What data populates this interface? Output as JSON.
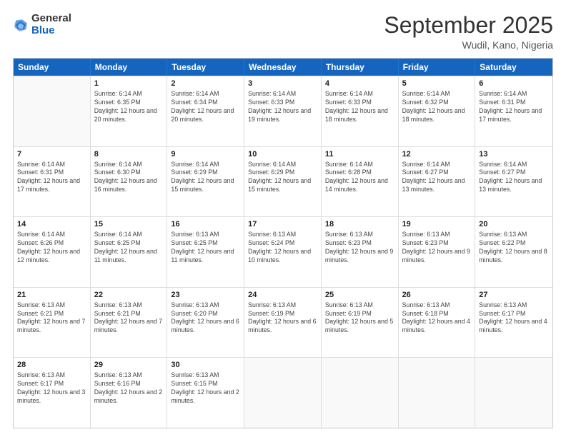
{
  "header": {
    "logo_general": "General",
    "logo_blue": "Blue",
    "month_year": "September 2025",
    "location": "Wudil, Kano, Nigeria"
  },
  "days_of_week": [
    "Sunday",
    "Monday",
    "Tuesday",
    "Wednesday",
    "Thursday",
    "Friday",
    "Saturday"
  ],
  "weeks": [
    [
      {
        "day": "",
        "empty": true
      },
      {
        "day": "1",
        "sunrise": "Sunrise: 6:14 AM",
        "sunset": "Sunset: 6:35 PM",
        "daylight": "Daylight: 12 hours and 20 minutes."
      },
      {
        "day": "2",
        "sunrise": "Sunrise: 6:14 AM",
        "sunset": "Sunset: 6:34 PM",
        "daylight": "Daylight: 12 hours and 20 minutes."
      },
      {
        "day": "3",
        "sunrise": "Sunrise: 6:14 AM",
        "sunset": "Sunset: 6:33 PM",
        "daylight": "Daylight: 12 hours and 19 minutes."
      },
      {
        "day": "4",
        "sunrise": "Sunrise: 6:14 AM",
        "sunset": "Sunset: 6:33 PM",
        "daylight": "Daylight: 12 hours and 18 minutes."
      },
      {
        "day": "5",
        "sunrise": "Sunrise: 6:14 AM",
        "sunset": "Sunset: 6:32 PM",
        "daylight": "Daylight: 12 hours and 18 minutes."
      },
      {
        "day": "6",
        "sunrise": "Sunrise: 6:14 AM",
        "sunset": "Sunset: 6:31 PM",
        "daylight": "Daylight: 12 hours and 17 minutes."
      }
    ],
    [
      {
        "day": "7",
        "sunrise": "Sunrise: 6:14 AM",
        "sunset": "Sunset: 6:31 PM",
        "daylight": "Daylight: 12 hours and 17 minutes."
      },
      {
        "day": "8",
        "sunrise": "Sunrise: 6:14 AM",
        "sunset": "Sunset: 6:30 PM",
        "daylight": "Daylight: 12 hours and 16 minutes."
      },
      {
        "day": "9",
        "sunrise": "Sunrise: 6:14 AM",
        "sunset": "Sunset: 6:29 PM",
        "daylight": "Daylight: 12 hours and 15 minutes."
      },
      {
        "day": "10",
        "sunrise": "Sunrise: 6:14 AM",
        "sunset": "Sunset: 6:29 PM",
        "daylight": "Daylight: 12 hours and 15 minutes."
      },
      {
        "day": "11",
        "sunrise": "Sunrise: 6:14 AM",
        "sunset": "Sunset: 6:28 PM",
        "daylight": "Daylight: 12 hours and 14 minutes."
      },
      {
        "day": "12",
        "sunrise": "Sunrise: 6:14 AM",
        "sunset": "Sunset: 6:27 PM",
        "daylight": "Daylight: 12 hours and 13 minutes."
      },
      {
        "day": "13",
        "sunrise": "Sunrise: 6:14 AM",
        "sunset": "Sunset: 6:27 PM",
        "daylight": "Daylight: 12 hours and 13 minutes."
      }
    ],
    [
      {
        "day": "14",
        "sunrise": "Sunrise: 6:14 AM",
        "sunset": "Sunset: 6:26 PM",
        "daylight": "Daylight: 12 hours and 12 minutes."
      },
      {
        "day": "15",
        "sunrise": "Sunrise: 6:14 AM",
        "sunset": "Sunset: 6:25 PM",
        "daylight": "Daylight: 12 hours and 11 minutes."
      },
      {
        "day": "16",
        "sunrise": "Sunrise: 6:13 AM",
        "sunset": "Sunset: 6:25 PM",
        "daylight": "Daylight: 12 hours and 11 minutes."
      },
      {
        "day": "17",
        "sunrise": "Sunrise: 6:13 AM",
        "sunset": "Sunset: 6:24 PM",
        "daylight": "Daylight: 12 hours and 10 minutes."
      },
      {
        "day": "18",
        "sunrise": "Sunrise: 6:13 AM",
        "sunset": "Sunset: 6:23 PM",
        "daylight": "Daylight: 12 hours and 9 minutes."
      },
      {
        "day": "19",
        "sunrise": "Sunrise: 6:13 AM",
        "sunset": "Sunset: 6:23 PM",
        "daylight": "Daylight: 12 hours and 9 minutes."
      },
      {
        "day": "20",
        "sunrise": "Sunrise: 6:13 AM",
        "sunset": "Sunset: 6:22 PM",
        "daylight": "Daylight: 12 hours and 8 minutes."
      }
    ],
    [
      {
        "day": "21",
        "sunrise": "Sunrise: 6:13 AM",
        "sunset": "Sunset: 6:21 PM",
        "daylight": "Daylight: 12 hours and 7 minutes."
      },
      {
        "day": "22",
        "sunrise": "Sunrise: 6:13 AM",
        "sunset": "Sunset: 6:21 PM",
        "daylight": "Daylight: 12 hours and 7 minutes."
      },
      {
        "day": "23",
        "sunrise": "Sunrise: 6:13 AM",
        "sunset": "Sunset: 6:20 PM",
        "daylight": "Daylight: 12 hours and 6 minutes."
      },
      {
        "day": "24",
        "sunrise": "Sunrise: 6:13 AM",
        "sunset": "Sunset: 6:19 PM",
        "daylight": "Daylight: 12 hours and 6 minutes."
      },
      {
        "day": "25",
        "sunrise": "Sunrise: 6:13 AM",
        "sunset": "Sunset: 6:19 PM",
        "daylight": "Daylight: 12 hours and 5 minutes."
      },
      {
        "day": "26",
        "sunrise": "Sunrise: 6:13 AM",
        "sunset": "Sunset: 6:18 PM",
        "daylight": "Daylight: 12 hours and 4 minutes."
      },
      {
        "day": "27",
        "sunrise": "Sunrise: 6:13 AM",
        "sunset": "Sunset: 6:17 PM",
        "daylight": "Daylight: 12 hours and 4 minutes."
      }
    ],
    [
      {
        "day": "28",
        "sunrise": "Sunrise: 6:13 AM",
        "sunset": "Sunset: 6:17 PM",
        "daylight": "Daylight: 12 hours and 3 minutes."
      },
      {
        "day": "29",
        "sunrise": "Sunrise: 6:13 AM",
        "sunset": "Sunset: 6:16 PM",
        "daylight": "Daylight: 12 hours and 2 minutes."
      },
      {
        "day": "30",
        "sunrise": "Sunrise: 6:13 AM",
        "sunset": "Sunset: 6:15 PM",
        "daylight": "Daylight: 12 hours and 2 minutes."
      },
      {
        "day": "",
        "empty": true
      },
      {
        "day": "",
        "empty": true
      },
      {
        "day": "",
        "empty": true
      },
      {
        "day": "",
        "empty": true
      }
    ]
  ]
}
